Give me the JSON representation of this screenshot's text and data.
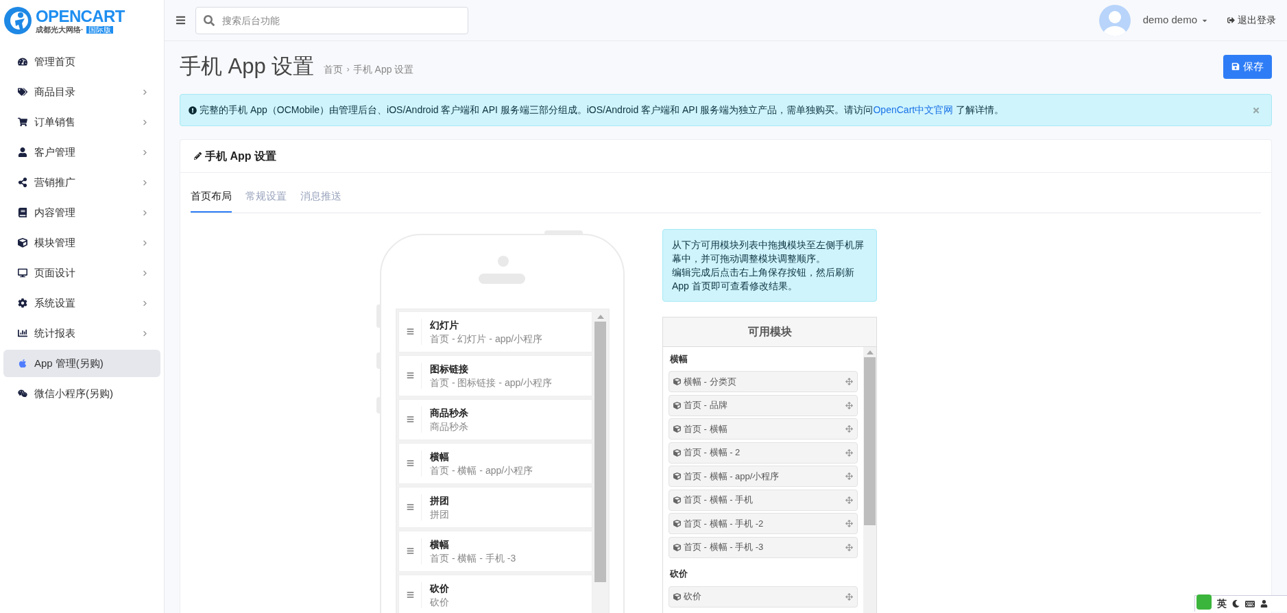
{
  "brand": {
    "name": "OPENCART",
    "tagline": "成都光大网络·",
    "edition": "国际版"
  },
  "search": {
    "placeholder": "搜索后台功能"
  },
  "user": {
    "name": "demo demo"
  },
  "logout": "退出登录",
  "sidebar": {
    "items": [
      {
        "label": "管理首页",
        "has_submenu": false,
        "selected": false
      },
      {
        "label": "商品目录",
        "has_submenu": true,
        "selected": false
      },
      {
        "label": "订单销售",
        "has_submenu": true,
        "selected": false
      },
      {
        "label": "客户管理",
        "has_submenu": true,
        "selected": false
      },
      {
        "label": "营销推广",
        "has_submenu": true,
        "selected": false
      },
      {
        "label": "内容管理",
        "has_submenu": true,
        "selected": false
      },
      {
        "label": "模块管理",
        "has_submenu": true,
        "selected": false
      },
      {
        "label": "页面设计",
        "has_submenu": true,
        "selected": false
      },
      {
        "label": "系统设置",
        "has_submenu": true,
        "selected": false
      },
      {
        "label": "统计报表",
        "has_submenu": true,
        "selected": false
      },
      {
        "label": "App 管理(另购)",
        "has_submenu": false,
        "selected": true
      },
      {
        "label": "微信小程序(另购)",
        "has_submenu": false,
        "selected": false
      }
    ]
  },
  "page": {
    "title": "手机 App 设置",
    "breadcrumbs": [
      "首页",
      "手机 App 设置"
    ],
    "breadcrumb_separator": "›",
    "save_button": "保存"
  },
  "alert": {
    "text": "完整的手机 App（OCMobile）由管理后台、iOS/Android 客户端和 API 服务端三部分组成。iOS/Android 客户端和 API 服务端为独立产品，需单独购买。请访问",
    "link": "OpenCart中文官网",
    "text_after": "了解详情。"
  },
  "card": {
    "title": "手机 App 设置"
  },
  "tabs": [
    {
      "label": "首页布局",
      "selected": true
    },
    {
      "label": "常规设置",
      "selected": false
    },
    {
      "label": "消息推送",
      "selected": false
    }
  ],
  "phone_modules": [
    {
      "title": "幻灯片",
      "subtitle": "首页 - 幻灯片 - app/小程序"
    },
    {
      "title": "图标链接",
      "subtitle": "首页 - 图标链接 - app/小程序"
    },
    {
      "title": "商品秒杀",
      "subtitle": "商品秒杀"
    },
    {
      "title": "横幅",
      "subtitle": "首页 - 横幅 - app/小程序"
    },
    {
      "title": "拼团",
      "subtitle": "拼团"
    },
    {
      "title": "横幅",
      "subtitle": "首页 - 横幅 - 手机 -3"
    },
    {
      "title": "砍价",
      "subtitle": "砍价"
    }
  ],
  "help": [
    "从下方可用模块列表中拖拽模块至左侧手机屏幕中，并可拖动调整模块调整顺序。",
    "编辑完成后点击右上角保存按钮，然后刷新 App 首页即可查看修改结果。"
  ],
  "available_modules": {
    "title": "可用模块",
    "groups": [
      {
        "title": "横幅",
        "items": [
          "横幅 - 分类页",
          "首页 - 品牌",
          "首页 - 横幅",
          "首页 - 横幅 - 2",
          "首页 - 横幅 - app/小程序",
          "首页 - 横幅 - 手机",
          "首页 - 横幅 - 手机 -2",
          "首页 - 横幅 - 手机 -3"
        ]
      },
      {
        "title": "砍价",
        "items": [
          "砍价"
        ]
      }
    ]
  },
  "ime_toolbar": {
    "mode": "英"
  }
}
